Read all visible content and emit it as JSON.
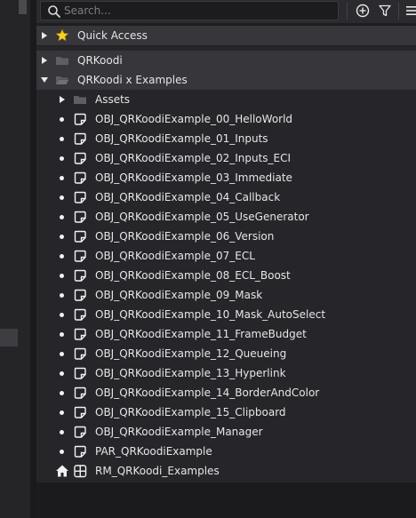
{
  "search": {
    "placeholder": "Search..."
  },
  "toolbar": {
    "icons": [
      "add-icon",
      "filter-icon",
      "menu-icon"
    ]
  },
  "quick_access": {
    "label": "Quick Access"
  },
  "folders": [
    {
      "label": "QRKoodi",
      "expanded": false
    },
    {
      "label": "QRKoodi x Examples",
      "expanded": true
    }
  ],
  "items": [
    {
      "label": "Assets",
      "kind": "folder"
    },
    {
      "label": "OBJ_QRKoodiExample_00_HelloWorld",
      "kind": "object"
    },
    {
      "label": "OBJ_QRKoodiExample_01_Inputs",
      "kind": "object"
    },
    {
      "label": "OBJ_QRKoodiExample_02_Inputs_ECI",
      "kind": "object"
    },
    {
      "label": "OBJ_QRKoodiExample_03_Immediate",
      "kind": "object"
    },
    {
      "label": "OBJ_QRKoodiExample_04_Callback",
      "kind": "object"
    },
    {
      "label": "OBJ_QRKoodiExample_05_UseGenerator",
      "kind": "object"
    },
    {
      "label": "OBJ_QRKoodiExample_06_Version",
      "kind": "object"
    },
    {
      "label": "OBJ_QRKoodiExample_07_ECL",
      "kind": "object"
    },
    {
      "label": "OBJ_QRKoodiExample_08_ECL_Boost",
      "kind": "object"
    },
    {
      "label": "OBJ_QRKoodiExample_09_Mask",
      "kind": "object"
    },
    {
      "label": "OBJ_QRKoodiExample_10_Mask_AutoSelect",
      "kind": "object"
    },
    {
      "label": "OBJ_QRKoodiExample_11_FrameBudget",
      "kind": "object"
    },
    {
      "label": "OBJ_QRKoodiExample_12_Queueing",
      "kind": "object"
    },
    {
      "label": "OBJ_QRKoodiExample_13_Hyperlink",
      "kind": "object"
    },
    {
      "label": "OBJ_QRKoodiExample_14_BorderAndColor",
      "kind": "object"
    },
    {
      "label": "OBJ_QRKoodiExample_15_Clipboard",
      "kind": "object"
    },
    {
      "label": "OBJ_QRKoodiExample_Manager",
      "kind": "object"
    },
    {
      "label": "PAR_QRKoodiExample",
      "kind": "object"
    },
    {
      "label": "RM_QRKoodi_Examples",
      "kind": "room"
    }
  ],
  "colors": {
    "star": "#f5d21e",
    "folder": "#5a5a60",
    "icon_fg": "#f2f2f2"
  }
}
